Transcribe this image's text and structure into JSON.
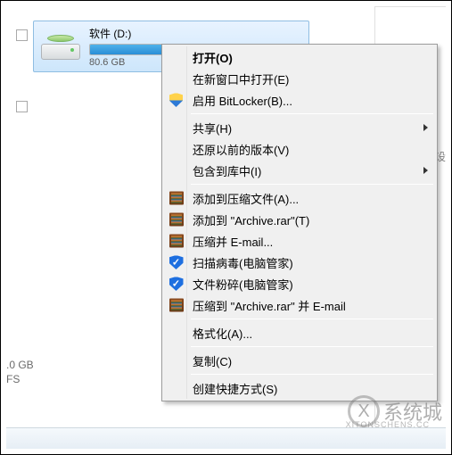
{
  "drive": {
    "name": "软件 (D:)",
    "free_text": "80.6 GB ",
    "fill_percent": 58
  },
  "partial": {
    "line1": ".0 GB",
    "line2": "FS"
  },
  "side_label": "设",
  "menu": {
    "open": "打开(O)",
    "open_new_window": "在新窗口中打开(E)",
    "bitlocker": "启用 BitLocker(B)...",
    "share": "共享(H)",
    "restore": "还原以前的版本(V)",
    "include_library": "包含到库中(I)",
    "add_archive": "添加到压缩文件(A)...",
    "add_archive_rar": "添加到 \"Archive.rar\"(T)",
    "compress_email": "压缩并 E-mail...",
    "scan_virus": "扫描病毒(电脑管家)",
    "file_shred": "文件粉碎(电脑管家)",
    "compress_to_email": "压缩到 \"Archive.rar\" 并 E-mail",
    "format": "格式化(A)...",
    "copy": "复制(C)",
    "create_shortcut": "创建快捷方式(S)"
  },
  "watermark": {
    "char": "X",
    "text": "系统城",
    "url": "XITONSCHENS.CC"
  }
}
